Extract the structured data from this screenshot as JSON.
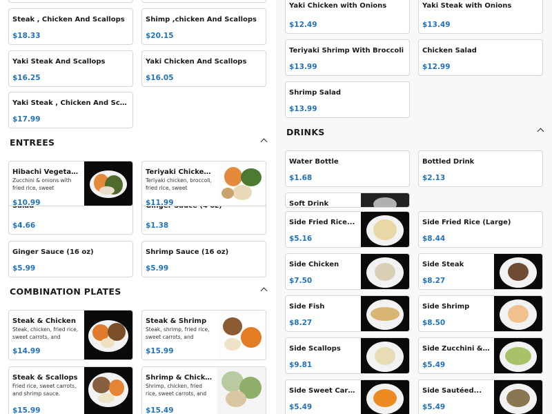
{
  "left": {
    "top_items": [
      {
        "name": "Steak , Chicken And Scallops",
        "price": "$18.33"
      },
      {
        "name": "Shimp ,chicken And Scallops",
        "price": "$20.15"
      },
      {
        "name": "Yaki Steak And Scallops",
        "price": "$16.25"
      },
      {
        "name": "Yaki Chicken And Scallops",
        "price": "$16.05"
      },
      {
        "name": "Yaki Steak , Chicken And Scallops",
        "price": "$17.99"
      }
    ],
    "entrees": {
      "title": "ENTREES",
      "items": [
        {
          "name": "Hibachi Vegetables",
          "desc": "Zucchini & onions with fried rice, sweet carrots,...",
          "price": "$10.99"
        },
        {
          "name": "Teriyaki Chicken...",
          "desc": "Teriyaki chicken, broccoli, fried rice, sweet carrots,...",
          "price": "$11.99"
        },
        {
          "name": "Salad",
          "price": "$4.66"
        },
        {
          "name": "Ginger Sauce (4 oz)",
          "price": "$1.38"
        },
        {
          "name": "Ginger Sauce (16 oz)",
          "price": "$5.99"
        },
        {
          "name": "Shrimp Sauce (16 oz)",
          "price": "$5.99"
        }
      ]
    },
    "combos": {
      "title": "COMBINATION PLATES",
      "items": [
        {
          "name": "Steak & Chicken",
          "desc": "Steak, chicken, fried rice, sweet carrots, and shrim...",
          "price": "$14.99"
        },
        {
          "name": "Steak & Shrimp",
          "desc": "Steak, shrimp, fried rice, sweet carrots, and shrim...",
          "price": "$15.99"
        },
        {
          "name": "Steak & Scallops",
          "desc": "Fried rice, sweet carrots, and shrimp sauce.",
          "price": "$15.99"
        },
        {
          "name": "Shrimp & Chicken",
          "desc": "Shrimp, chicken, fried rice, sweet carrots, and shrim...",
          "price": "$15.49"
        }
      ]
    }
  },
  "right": {
    "top_items": [
      {
        "name": "Yaki Chicken with Onions",
        "price": "$12.49"
      },
      {
        "name": "Yaki Steak with Onions",
        "price": "$13.49"
      },
      {
        "name": "Teriyaki Shrimp With Broccoli",
        "price": "$13.99"
      },
      {
        "name": "Chicken Salad",
        "price": "$12.99"
      },
      {
        "name": "Shrimp Salad",
        "price": "$13.99"
      }
    ],
    "drinks": {
      "title": "DRINKS",
      "items": [
        {
          "name": "Water Bottle",
          "price": "$1.68"
        },
        {
          "name": "Bottled Drink",
          "price": "$2.13"
        },
        {
          "name": "Soft Drink"
        },
        {
          "name": "Side Fried Rice...",
          "price": "$5.16"
        },
        {
          "name": "Side Fried Rice (Large)",
          "price": "$8.44"
        },
        {
          "name": "Side Chicken",
          "price": "$7.50"
        },
        {
          "name": "Side Steak",
          "price": "$8.27"
        },
        {
          "name": "Side Fish",
          "price": "$8.27"
        },
        {
          "name": "Side Shrimp",
          "price": "$8.50"
        },
        {
          "name": "Side Scallops",
          "price": "$9.81"
        },
        {
          "name": "Side Zucchini &...",
          "price": "$5.49"
        },
        {
          "name": "Side Sweet Carrots",
          "price": "$5.49"
        },
        {
          "name": "Side Sautéed...",
          "price": "$5.49"
        }
      ]
    }
  },
  "icons": {
    "collapse": "chevron-up-icon"
  },
  "colors": {
    "price": "#2172b8",
    "border": "#d6d6d6"
  }
}
